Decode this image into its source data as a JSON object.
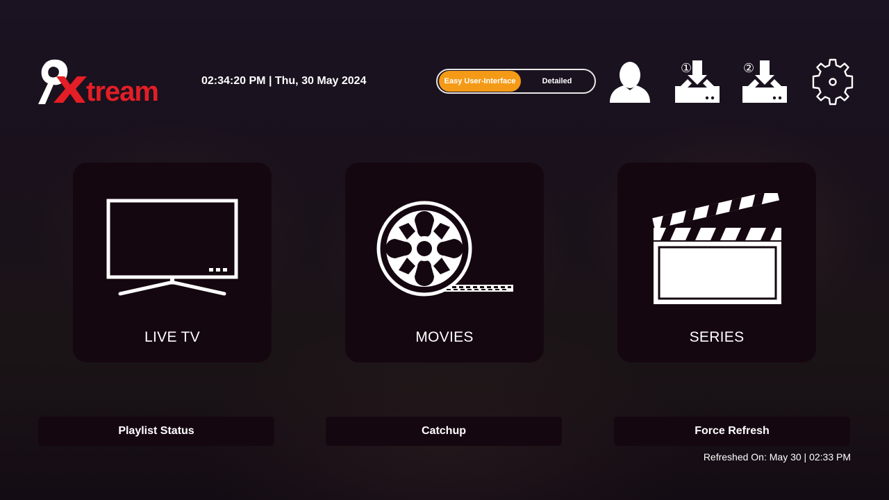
{
  "app": {
    "logo_text": "9Xtream",
    "brand_color": "#e41e26"
  },
  "header": {
    "clock": "02:34:20 PM | Thu, 30 May 2024",
    "mode_toggle": {
      "options": [
        "Easy User-Interface",
        "Detailed"
      ],
      "selected": "Easy User-Interface",
      "accent_color": "#f59a16"
    },
    "icons": [
      {
        "name": "profile-icon"
      },
      {
        "name": "download-icon",
        "badge": "①"
      },
      {
        "name": "download-icon",
        "badge": "②"
      },
      {
        "name": "settings-icon"
      }
    ]
  },
  "tiles": [
    {
      "label": "LIVE TV",
      "icon": "tv-icon"
    },
    {
      "label": "MOVIES",
      "icon": "film-reel-icon"
    },
    {
      "label": "SERIES",
      "icon": "clapperboard-icon"
    }
  ],
  "actions": {
    "playlist_status": "Playlist Status",
    "catchup": "Catchup",
    "force_refresh": "Force Refresh"
  },
  "footer": {
    "refreshed": "Refreshed On: May 30 | 02:33 PM"
  }
}
